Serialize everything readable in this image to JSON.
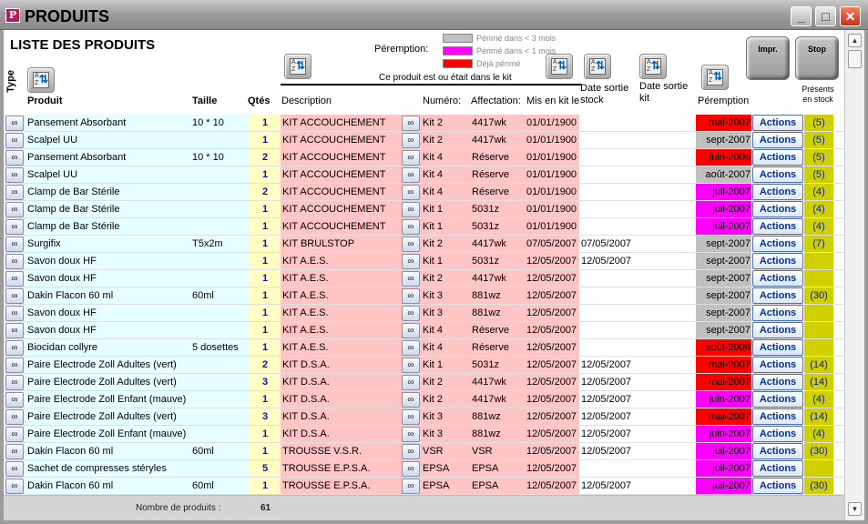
{
  "window": {
    "title": "PRODUITS",
    "min": "_",
    "max": "□",
    "close": "✕"
  },
  "header": {
    "list_title": "LISTE DES PRODUITS",
    "peremption_label": "Péremption:",
    "legend": [
      {
        "color": "#c0c0c0",
        "text": "Périmé dans < 3 mois"
      },
      {
        "color": "#ff00ff",
        "text": "Périmé dans < 1 mois"
      },
      {
        "color": "#ff0000",
        "text": "Déjà périmé"
      }
    ],
    "impr_label": "Impr.",
    "stop_label": "Stop",
    "kit_label": "Ce produit est ou était dans le kit",
    "columns": {
      "type": "Type",
      "produit": "Produit",
      "taille": "Taille",
      "qtes": "Qtés",
      "description": "Description",
      "numero": "Numéro:",
      "affectation": "Affectation:",
      "mis_en_kit": "Mis en kit le",
      "date_sortie_stock": "Date sortie stock",
      "date_sortie_kit": "Date sortie kit",
      "peremption": "Péremption",
      "presents_stock": "Présents en stock"
    }
  },
  "colors": {
    "red": "#ff0000",
    "magenta": "#ff00ff",
    "grey": "#c0c0c0"
  },
  "rows": [
    {
      "produit": "Pansement Absorbant",
      "taille": "10 * 10",
      "qte": "1",
      "desc": "KIT ACCOUCHEMENT",
      "num": "Kit 2",
      "aff": "4417wk",
      "mis": "01/01/1900",
      "sortie_stock": "",
      "sortie_kit": "",
      "per": "mai-2007",
      "per_color": "#ff0000",
      "action": "Actions",
      "stock": "(5)"
    },
    {
      "produit": "Scalpel UU",
      "taille": "",
      "qte": "1",
      "desc": "KIT ACCOUCHEMENT",
      "num": "Kit 2",
      "aff": "4417wk",
      "mis": "01/01/1900",
      "sortie_stock": "",
      "sortie_kit": "",
      "per": "sept-2007",
      "per_color": "#c0c0c0",
      "action": "Actions",
      "stock": "(5)"
    },
    {
      "produit": "Pansement Absorbant",
      "taille": "10 * 10",
      "qte": "2",
      "desc": "KIT ACCOUCHEMENT",
      "num": "Kit 4",
      "aff": "Réserve",
      "mis": "01/01/1900",
      "sortie_stock": "",
      "sortie_kit": "",
      "per": "juin-2006",
      "per_color": "#ff0000",
      "action": "Actions",
      "stock": "(5)"
    },
    {
      "produit": "Scalpel UU",
      "taille": "",
      "qte": "1",
      "desc": "KIT ACCOUCHEMENT",
      "num": "Kit 4",
      "aff": "Réserve",
      "mis": "01/01/1900",
      "sortie_stock": "",
      "sortie_kit": "",
      "per": "août-2007",
      "per_color": "#c0c0c0",
      "action": "Actions",
      "stock": "(5)"
    },
    {
      "produit": "Clamp de Bar Stérile",
      "taille": "",
      "qte": "2",
      "desc": "KIT ACCOUCHEMENT",
      "num": "Kit 4",
      "aff": "Réserve",
      "mis": "01/01/1900",
      "sortie_stock": "",
      "sortie_kit": "",
      "per": "juil-2007",
      "per_color": "#ff00ff",
      "action": "Actions",
      "stock": "(4)"
    },
    {
      "produit": "Clamp de Bar Stérile",
      "taille": "",
      "qte": "1",
      "desc": "KIT ACCOUCHEMENT",
      "num": "Kit 1",
      "aff": "5031z",
      "mis": "01/01/1900",
      "sortie_stock": "",
      "sortie_kit": "",
      "per": "juil-2007",
      "per_color": "#ff00ff",
      "action": "Actions",
      "stock": "(4)"
    },
    {
      "produit": "Clamp de Bar Stérile",
      "taille": "",
      "qte": "1",
      "desc": "KIT ACCOUCHEMENT",
      "num": "Kit 1",
      "aff": "5031z",
      "mis": "01/01/1900",
      "sortie_stock": "",
      "sortie_kit": "",
      "per": "juil-2007",
      "per_color": "#ff00ff",
      "action": "Actions",
      "stock": "(4)"
    },
    {
      "produit": "Surgifix",
      "taille": "T5x2m",
      "qte": "1",
      "desc": "KIT BRULSTOP",
      "num": "Kit 2",
      "aff": "4417wk",
      "mis": "07/05/2007",
      "sortie_stock": "07/05/2007",
      "sortie_kit": "",
      "per": "sept-2007",
      "per_color": "#c0c0c0",
      "action": "Actions",
      "stock": "(7)"
    },
    {
      "produit": "Savon doux HF",
      "taille": "",
      "qte": "1",
      "desc": "KIT A.E.S.",
      "num": "Kit 1",
      "aff": "5031z",
      "mis": "12/05/2007",
      "sortie_stock": "12/05/2007",
      "sortie_kit": "",
      "per": "sept-2007",
      "per_color": "#c0c0c0",
      "action": "Actions",
      "stock": ""
    },
    {
      "produit": "Savon doux HF",
      "taille": "",
      "qte": "1",
      "desc": "KIT A.E.S.",
      "num": "Kit 2",
      "aff": "4417wk",
      "mis": "12/05/2007",
      "sortie_stock": "",
      "sortie_kit": "",
      "per": "sept-2007",
      "per_color": "#c0c0c0",
      "action": "Actions",
      "stock": ""
    },
    {
      "produit": "Dakin Flacon 60 ml",
      "taille": "60ml",
      "qte": "1",
      "desc": "KIT A.E.S.",
      "num": "Kit 3",
      "aff": "881wz",
      "mis": "12/05/2007",
      "sortie_stock": "",
      "sortie_kit": "",
      "per": "sept-2007",
      "per_color": "#c0c0c0",
      "action": "Actions",
      "stock": "(30)"
    },
    {
      "produit": "Savon doux HF",
      "taille": "",
      "qte": "1",
      "desc": "KIT A.E.S.",
      "num": "Kit 3",
      "aff": "881wz",
      "mis": "12/05/2007",
      "sortie_stock": "",
      "sortie_kit": "",
      "per": "sept-2007",
      "per_color": "#c0c0c0",
      "action": "Actions",
      "stock": ""
    },
    {
      "produit": "Savon doux HF",
      "taille": "",
      "qte": "1",
      "desc": "KIT A.E.S.",
      "num": "Kit 4",
      "aff": "Réserve",
      "mis": "12/05/2007",
      "sortie_stock": "",
      "sortie_kit": "",
      "per": "sept-2007",
      "per_color": "#c0c0c0",
      "action": "Actions",
      "stock": ""
    },
    {
      "produit": "Biocidan collyre",
      "taille": "5 dosettes",
      "qte": "1",
      "desc": "KIT A.E.S.",
      "num": "Kit 4",
      "aff": "Réserve",
      "mis": "12/05/2007",
      "sortie_stock": "",
      "sortie_kit": "",
      "per": "août-2006",
      "per_color": "#ff0000",
      "action": "Actions",
      "stock": ""
    },
    {
      "produit": "Paire Electrode Zoll Adultes (vert)",
      "taille": "",
      "qte": "2",
      "desc": "KIT D.S.A.",
      "num": "Kit 1",
      "aff": "5031z",
      "mis": "12/05/2007",
      "sortie_stock": "12/05/2007",
      "sortie_kit": "",
      "per": "mai-2007",
      "per_color": "#ff0000",
      "action": "Actions",
      "stock": "(14)"
    },
    {
      "produit": "Paire Electrode Zoll Adultes (vert)",
      "taille": "",
      "qte": "3",
      "desc": "KIT D.S.A.",
      "num": "Kit 2",
      "aff": "4417wk",
      "mis": "12/05/2007",
      "sortie_stock": "12/05/2007",
      "sortie_kit": "",
      "per": "mai-2007",
      "per_color": "#ff0000",
      "action": "Actions",
      "stock": "(14)"
    },
    {
      "produit": "Paire Electrode Zoll Enfant (mauve)",
      "taille": "",
      "qte": "1",
      "desc": "KIT D.S.A.",
      "num": "Kit 2",
      "aff": "4417wk",
      "mis": "12/05/2007",
      "sortie_stock": "12/05/2007",
      "sortie_kit": "",
      "per": "juin-2007",
      "per_color": "#ff00ff",
      "action": "Actions",
      "stock": "(4)"
    },
    {
      "produit": "Paire Electrode Zoll Adultes (vert)",
      "taille": "",
      "qte": "3",
      "desc": "KIT D.S.A.",
      "num": "Kit 3",
      "aff": "881wz",
      "mis": "12/05/2007",
      "sortie_stock": "12/05/2007",
      "sortie_kit": "",
      "per": "mai-2007",
      "per_color": "#ff0000",
      "action": "Actions",
      "stock": "(14)"
    },
    {
      "produit": "Paire Electrode Zoll Enfant (mauve)",
      "taille": "",
      "qte": "1",
      "desc": "KIT D.S.A.",
      "num": "Kit 3",
      "aff": "881wz",
      "mis": "12/05/2007",
      "sortie_stock": "12/05/2007",
      "sortie_kit": "",
      "per": "juin-2007",
      "per_color": "#ff00ff",
      "action": "Actions",
      "stock": "(4)"
    },
    {
      "produit": "Dakin Flacon 60 ml",
      "taille": "60ml",
      "qte": "1",
      "desc": "TROUSSE V.S.R.",
      "num": "VSR",
      "aff": "VSR",
      "mis": "12/05/2007",
      "sortie_stock": "12/05/2007",
      "sortie_kit": "",
      "per": "juil-2007",
      "per_color": "#ff00ff",
      "action": "Actions",
      "stock": "(30)"
    },
    {
      "produit": "Sachet de compresses stéryles",
      "taille": "",
      "qte": "5",
      "desc": "TROUSSE E.P.S.A.",
      "num": "EPSA",
      "aff": "EPSA",
      "mis": "12/05/2007",
      "sortie_stock": "",
      "sortie_kit": "",
      "per": "juil-2007",
      "per_color": "#ff00ff",
      "action": "Actions",
      "stock": ""
    },
    {
      "produit": "Dakin Flacon 60 ml",
      "taille": "60ml",
      "qte": "1",
      "desc": "TROUSSE E.P.S.A.",
      "num": "EPSA",
      "aff": "EPSA",
      "mis": "12/05/2007",
      "sortie_stock": "12/05/2007",
      "sortie_kit": "",
      "per": "juil-2007",
      "per_color": "#ff00ff",
      "action": "Actions",
      "stock": "(30)"
    }
  ],
  "footer": {
    "label": "Nombre de produits :",
    "count": "61"
  },
  "icons": {
    "glasses": "glasses-icon",
    "sort": "sort-az-icon",
    "print": "print-icon",
    "stop": "stop-icon"
  }
}
